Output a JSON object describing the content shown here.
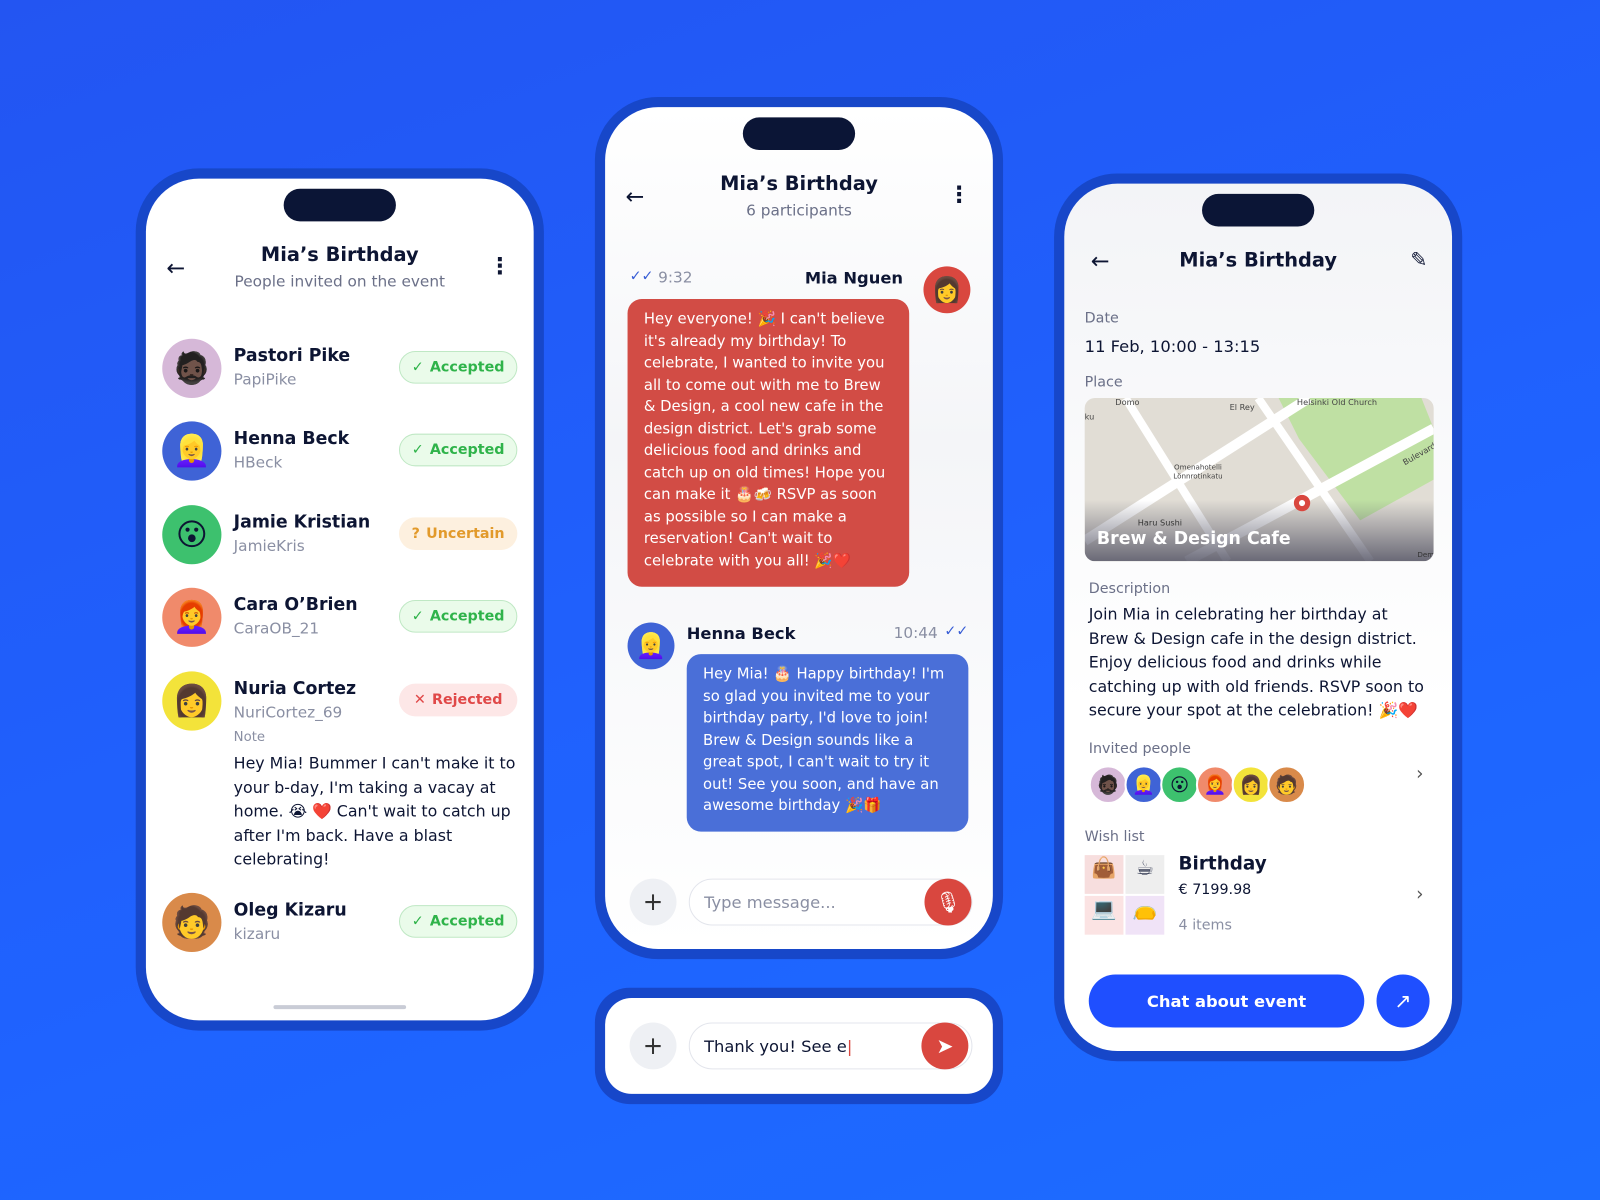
{
  "colors": {
    "background": "#1f63ff",
    "frame": "#1747c9",
    "accent": "#1f4fff",
    "red": "#d9473f",
    "blue_bubble": "#4a6fd8"
  },
  "invited_screen": {
    "title": "Mia’s Birthday",
    "subtitle": "People invited on the event",
    "people": [
      {
        "name": "Pastori Pike",
        "handle": "PapiPike",
        "status": "Accepted",
        "status_icon": "check",
        "avatar": "🧔🏿",
        "avatar_bg": "#d6b8d8"
      },
      {
        "name": "Henna Beck",
        "handle": "HBeck",
        "status": "Accepted",
        "status_icon": "check",
        "avatar": "👱‍♀️",
        "avatar_bg": "#3f63d6"
      },
      {
        "name": "Jamie Kristian",
        "handle": "JamieKris",
        "status": "Uncertain",
        "status_icon": "?",
        "avatar": "😮",
        "avatar_bg": "#3dc16e"
      },
      {
        "name": "Cara O’Brien",
        "handle": "CaraOB_21",
        "status": "Accepted",
        "status_icon": "check",
        "avatar": "👩‍🦰",
        "avatar_bg": "#f08a6b"
      },
      {
        "name": "Nuria Cortez",
        "handle": "NuriCortez_69",
        "status": "Rejected",
        "status_icon": "x",
        "avatar": "👩",
        "avatar_bg": "#f3e33a",
        "note_label": "Note",
        "note": "Hey Mia! Bummer I can't make it to your b-day, I'm taking a vacay at home. 😭 ❤️ Can't wait to catch up after I'm back. Have a blast celebrating!"
      },
      {
        "name": "Oleg Kizaru",
        "handle": "kizaru",
        "status": "Accepted",
        "status_icon": "check",
        "avatar": "🧑",
        "avatar_bg": "#d98a4a"
      }
    ]
  },
  "chat_screen": {
    "title": "Mia’s Birthday",
    "subtitle": "6 participants",
    "messages": [
      {
        "sender": "Mia Nguen",
        "time": "9:32",
        "text": "Hey everyone! 🎉 I can't believe it's already my birthday! To celebrate, I wanted to invite you all to come out with me to Brew & Design, a cool new cafe in the design district. Let's grab some delicious food and drinks and catch up on old times! Hope you can make it 🎂🍻 RSVP as soon as possible so I can make a reservation! Can't wait to celebrate with you all! 🎉❤️"
      },
      {
        "sender": "Henna Beck",
        "time": "10:44",
        "text": "Hey Mia! 🎂 Happy birthday! I'm so glad you invited me to your birthday party, I'd love to join! Brew & Design sounds like a great spot, I can't wait to try it out! See you soon, and have an awesome birthday 🎉🎁"
      }
    ],
    "input_placeholder": "Type message..."
  },
  "compose_card": {
    "input_value": "Thank you! See e"
  },
  "details_screen": {
    "title": "Mia’s Birthday",
    "date_label": "Date",
    "date_value": "11 Feb, 10:00 - 13:15",
    "place_label": "Place",
    "place_name": "Brew & Design Cafe",
    "map_labels": [
      "Domo",
      "El Rey",
      "Helsinki Old Church",
      "Omenahotelli Lönnrotinkatu",
      "Haru Sushi",
      "Bulevardi",
      "ku",
      "Dem"
    ],
    "description_label": "Description",
    "description": "Join Mia in celebrating her birthday at Brew & Design cafe in the design district. Enjoy delicious food and drinks while catching up with old friends. RSVP soon to secure your spot at the celebration! 🎉❤️",
    "invited_label": "Invited people",
    "wishlist_label": "Wish list",
    "wishlist_name": "Birthday",
    "wishlist_price": "€ 7199.98",
    "wishlist_count": "4 items",
    "chat_button": "Chat about event"
  }
}
